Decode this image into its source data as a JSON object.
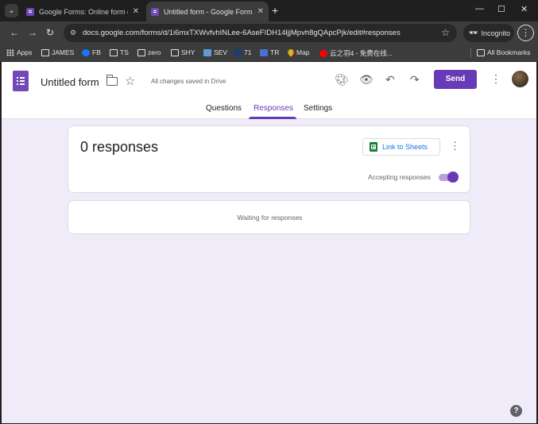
{
  "browser": {
    "tabs": [
      {
        "title": "Google Forms: Online form cre",
        "active": false
      },
      {
        "title": "Untitled form - Google Forms",
        "active": true
      }
    ],
    "url": "docs.google.com/forms/d/1i6mxTXWvfvhINLee-6AseFIDH14ljjMpvh8gQApcPjk/edit#responses",
    "profile": "Incognito",
    "bookmarks": [
      "Apps",
      "JAMES",
      "FB",
      "TS",
      "zero",
      "SHY",
      "SEV",
      "71",
      "TR",
      "Map",
      "云之羽4 - 免费在线..."
    ],
    "all_bookmarks": "All Bookmarks"
  },
  "form": {
    "title": "Untitled form",
    "save_status": "All changes saved in Drive",
    "send_label": "Send",
    "tabs": [
      {
        "label": "Questions",
        "active": false
      },
      {
        "label": "Responses",
        "active": true
      },
      {
        "label": "Settings",
        "active": false
      }
    ]
  },
  "responses": {
    "count_label": "0 responses",
    "link_sheets_label": "Link to Sheets",
    "accepting_label": "Accepting responses",
    "accepting": true,
    "waiting_text": "Waiting for responses"
  },
  "colors": {
    "accent": "#673ab7",
    "background": "#f0ebf8",
    "sheets_green": "#188038"
  }
}
